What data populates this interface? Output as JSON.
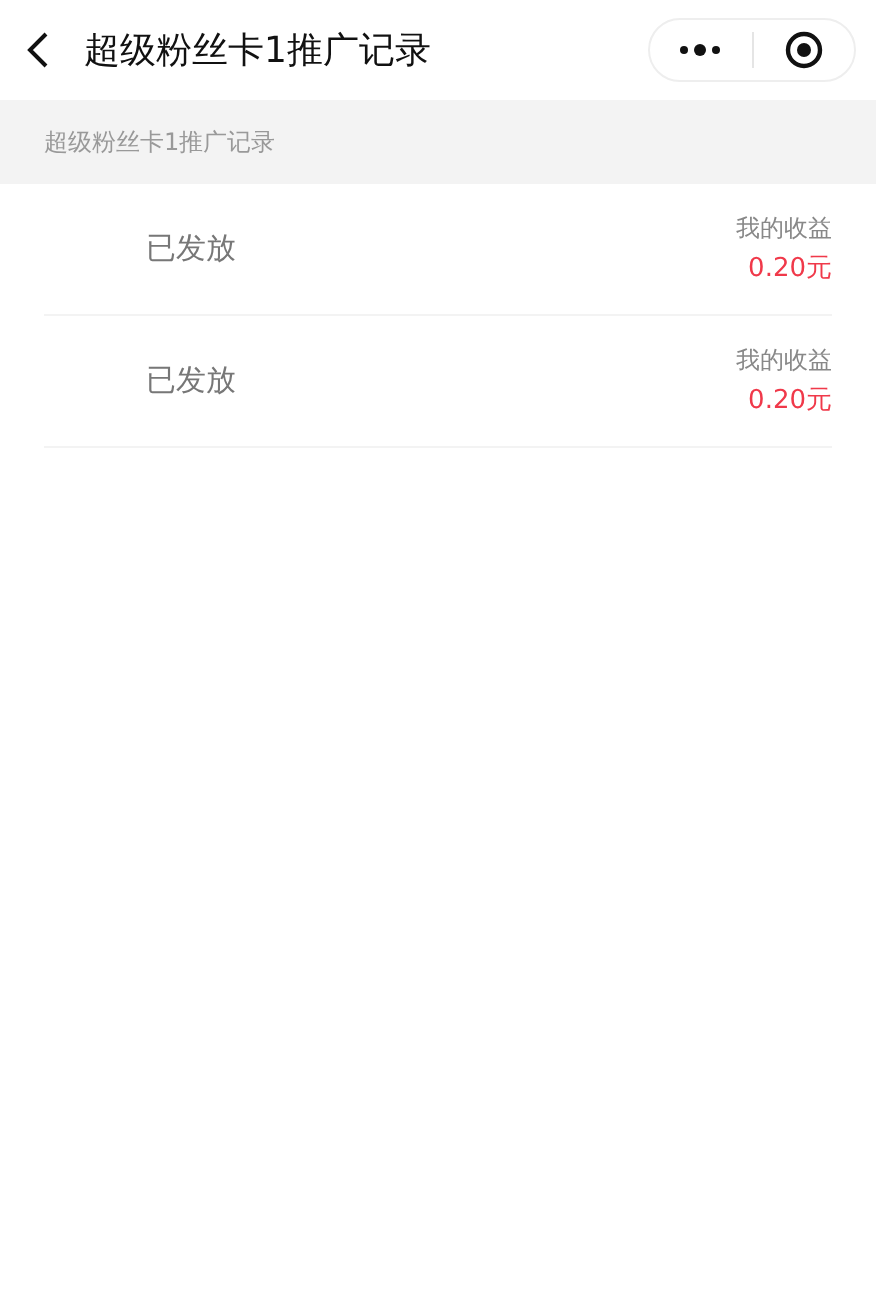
{
  "nav": {
    "title": "超级粉丝卡1推广记录"
  },
  "section_header": "超级粉丝卡1推广记录",
  "records": [
    {
      "status": "已发放",
      "earnings_label": "我的收益",
      "amount": "0.20元"
    },
    {
      "status": "已发放",
      "earnings_label": "我的收益",
      "amount": "0.20元"
    }
  ]
}
